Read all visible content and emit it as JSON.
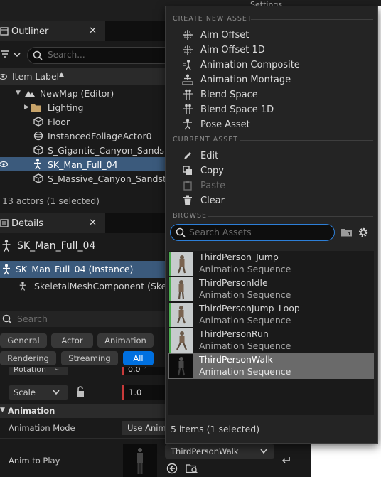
{
  "topbar": {
    "settings_label": "Settings"
  },
  "outliner": {
    "tab_label": "Outliner",
    "search_placeholder": "Search...",
    "column_header": "Item Label",
    "items": [
      {
        "label": "NewMap (Editor)"
      },
      {
        "label": "Lighting"
      },
      {
        "label": "Floor"
      },
      {
        "label": "InstancedFoliageActor0"
      },
      {
        "label": "S_Gigantic_Canyon_Sandsto"
      },
      {
        "label": "SK_Man_Full_04"
      },
      {
        "label": "S_Massive_Canyon_Sandsto"
      }
    ],
    "status": "13 actors (1 selected)"
  },
  "details": {
    "tab_label": "Details",
    "title": "SK_Man_Full_04",
    "instance_label": "SK_Man_Full_04 (Instance)",
    "component_label": "SkeletalMeshComponent (Skele",
    "search_placeholder": "Search",
    "filters": [
      "General",
      "Actor",
      "Animation",
      "Rendering",
      "Streaming",
      "All"
    ],
    "rotation_label": "Rotation",
    "rotation_value": "0.0 °",
    "scale_label": "Scale",
    "scale_value": "1.0",
    "section_animation": "Animation",
    "anim_mode_label": "Animation Mode",
    "anim_mode_value": "Use Anima",
    "anim_to_play_label": "Anim to Play",
    "anim_to_play_value": "ThirdPersonWalk"
  },
  "menu": {
    "section_create": "CREATE NEW ASSET",
    "create_items": [
      "Aim Offset",
      "Aim Offset 1D",
      "Animation Composite",
      "Animation Montage",
      "Blend Space",
      "Blend Space 1D",
      "Pose Asset"
    ],
    "section_current": "CURRENT ASSET",
    "current_items": [
      "Edit",
      "Copy",
      "Paste",
      "Clear"
    ],
    "section_browse": "BROWSE",
    "search_placeholder": "Search Assets",
    "assets": [
      {
        "name": "ThirdPerson_Jump",
        "type": "Animation Sequence"
      },
      {
        "name": "ThirdPersonIdle",
        "type": "Animation Sequence"
      },
      {
        "name": "ThirdPersonJump_Loop",
        "type": "Animation Sequence"
      },
      {
        "name": "ThirdPersonRun",
        "type": "Animation Sequence"
      },
      {
        "name": "ThirdPersonWalk",
        "type": "Animation Sequence"
      }
    ],
    "count": "5 items (1 selected)"
  },
  "colors": {
    "accent": "#0070e0",
    "selection": "#3b5a7c",
    "asset_selection": "#6a6a6a"
  }
}
